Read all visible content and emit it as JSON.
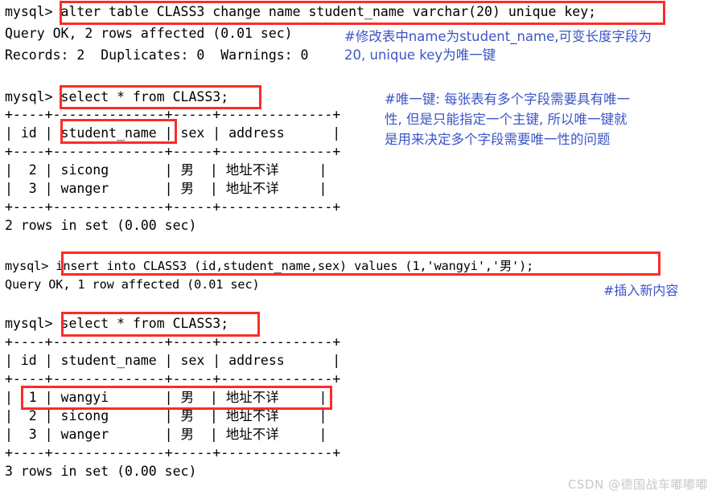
{
  "terminal": {
    "prompt": "mysql>",
    "blocks": [
      {
        "id": "block-alter",
        "lines": [
          "mysql> alter table CLASS3 change name student_name varchar(20) unique key;",
          "Query OK, 2 rows affected (0.01 sec)",
          "Records: 2  Duplicates: 0  Warnings: 0"
        ]
      },
      {
        "id": "block-select-1",
        "lines": [
          "mysql> select * from CLASS3;",
          "+----+--------------+-----+--------------+",
          "| id | student_name | sex | address      |",
          "+----+--------------+-----+--------------+",
          "|  2 | sicong       | 男  | 地址不详     |",
          "|  3 | wanger       | 男  | 地址不详     |",
          "+----+--------------+-----+--------------+",
          "2 rows in set (0.00 sec)"
        ]
      },
      {
        "id": "block-insert",
        "lines": [
          "mysql> insert into CLASS3 (id,student_name,sex) values (1,'wangyi','男');",
          "Query OK, 1 row affected (0.01 sec)"
        ]
      },
      {
        "id": "block-select-2",
        "lines": [
          "mysql> select * from CLASS3;",
          "+----+--------------+-----+--------------+",
          "| id | student_name | sex | address      |",
          "+----+--------------+-----+--------------+",
          "|  1 | wangyi       | 男  | 地址不详     |",
          "|  2 | sicong       | 男  | 地址不详     |",
          "|  3 | wanger       | 男  | 地址不详     |",
          "+----+--------------+-----+--------------+",
          "3 rows in set (0.00 sec)"
        ]
      }
    ],
    "commands": {
      "alter": "alter table CLASS3 change name student_name varchar(20) unique key;",
      "select_1": "select * from CLASS3;",
      "insert": "insert into CLASS3 (id,student_name,sex) values (1,'wangyi','男');",
      "select_2": "select * from CLASS3;"
    },
    "results": {
      "alter_status": "Query OK, 2 rows affected (0.01 sec)",
      "alter_records": "Records: 2  Duplicates: 0  Warnings: 0",
      "insert_status": "Query OK, 1 row affected (0.01 sec)",
      "rowcount_1": "2 rows in set (0.00 sec)",
      "rowcount_2": "3 rows in set (0.00 sec)"
    },
    "table_1": {
      "separator": "+----+--------------+-----+--------------+",
      "header": "| id | student_name | sex | address      |",
      "rows": [
        "|  2 | sicong       | 男  | 地址不详     |",
        "|  3 | wanger       | 男  | 地址不详     |"
      ],
      "columns": [
        "id",
        "student_name",
        "sex",
        "address"
      ],
      "data": [
        {
          "id": "2",
          "student_name": "sicong",
          "sex": "男",
          "address": "地址不详"
        },
        {
          "id": "3",
          "student_name": "wanger",
          "sex": "男",
          "address": "地址不详"
        }
      ]
    },
    "table_2": {
      "separator": "+----+--------------+-----+--------------+",
      "header": "| id | student_name | sex | address      |",
      "rows": [
        "|  1 | wangyi       | 男  | 地址不详     |",
        "|  2 | sicong       | 男  | 地址不详     |",
        "|  3 | wanger       | 男  | 地址不详     |"
      ],
      "columns": [
        "id",
        "student_name",
        "sex",
        "address"
      ],
      "data": [
        {
          "id": "1",
          "student_name": "wangyi",
          "sex": "男",
          "address": "地址不详"
        },
        {
          "id": "2",
          "student_name": "sicong",
          "sex": "男",
          "address": "地址不详"
        },
        {
          "id": "3",
          "student_name": "wanger",
          "sex": "男",
          "address": "地址不详"
        }
      ]
    }
  },
  "annotations": {
    "alter_note_line1": "#修改表中name为student_name,可变长度字段为",
    "alter_note_line2": "20, unique key为唯一键",
    "unique_note_line1": "#唯一键: 每张表有多个字段需要具有唯一",
    "unique_note_line2": "性, 但是只能指定一个主键, 所以唯一键就",
    "unique_note_line3": "是用来决定多个字段需要唯一性的问题",
    "insert_note": "#插入新内容",
    "color": "#3c55c8"
  },
  "highlights": {
    "color": "#fb2c27",
    "boxes": [
      {
        "name": "alter-command",
        "label": "alter table CLASS3 change name student_name varchar(20) unique key;"
      },
      {
        "name": "select-command-1",
        "label": "select * from CLASS3;"
      },
      {
        "name": "student-name-column-header",
        "label": "student_name"
      },
      {
        "name": "insert-command",
        "label": "insert into CLASS3 (id,student_name,sex) values (1,'wangyi','男');"
      },
      {
        "name": "select-command-2",
        "label": "select * from CLASS3;"
      },
      {
        "name": "inserted-row",
        "label": "|  1 | wangyi       | 男  | 地址不详     |"
      }
    ]
  },
  "watermark": {
    "text": "CSDN @德国战车嘟嘟嘟"
  }
}
